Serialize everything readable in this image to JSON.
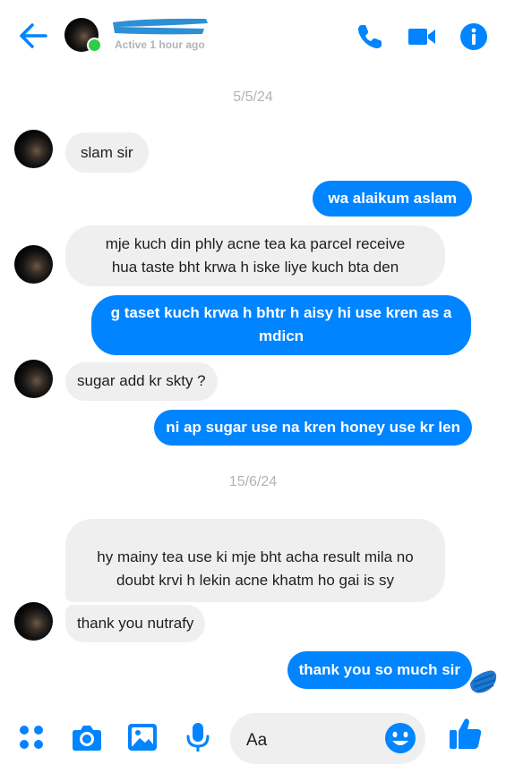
{
  "header": {
    "status": "Active 1 hour ago"
  },
  "dates": [
    "5/5/24",
    "15/6/24"
  ],
  "messages": [
    {
      "dir": "in",
      "text": "slam sir"
    },
    {
      "dir": "out",
      "text": "wa alaikum aslam"
    },
    {
      "dir": "in",
      "lines": [
        "mje kuch din phly acne tea ka parcel receive",
        "hua taste bht krwa h iske liye kuch bta den"
      ]
    },
    {
      "dir": "out",
      "lines": [
        "g taset kuch krwa h bhtr h aisy hi use kren as a",
        "mdicn"
      ]
    },
    {
      "dir": "in",
      "text": "sugar add kr skty ?"
    },
    {
      "dir": "out",
      "text": "ni ap sugar use na kren honey use kr len"
    },
    {
      "dir": "in",
      "lines": [
        "hy mainy tea use ki mje bht acha result mila no",
        "doubt krvi h lekin acne khatm ho gai is sy"
      ]
    },
    {
      "dir": "in",
      "text": "thank you nutrafy"
    },
    {
      "dir": "out",
      "text": "thank you so much sir"
    }
  ],
  "composer": {
    "placeholder": "Aa"
  },
  "colors": {
    "accent": "#0084ff",
    "incoming_bubble": "#efefef",
    "online": "#31cc46",
    "muted_text": "#b0b3b8"
  },
  "icons": {
    "header": [
      "back-arrow-icon",
      "phone-icon",
      "video-camera-icon",
      "info-icon"
    ],
    "composer": [
      "menu-dots-icon",
      "camera-icon",
      "gallery-icon",
      "microphone-icon",
      "emoji-icon",
      "thumbs-up-icon"
    ]
  }
}
